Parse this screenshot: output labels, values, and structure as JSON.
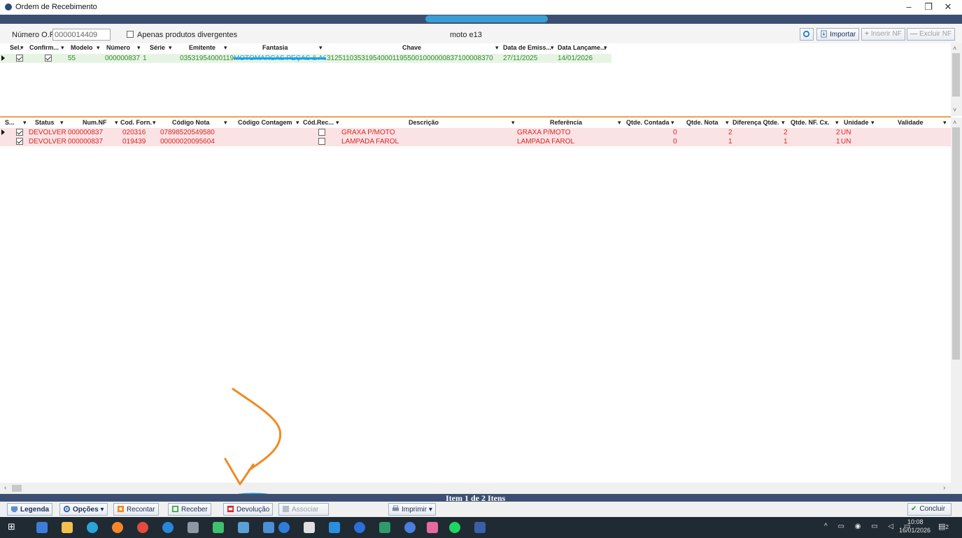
{
  "window": {
    "title": "Ordem de Recebimento",
    "minimize": "–",
    "restore": "❐",
    "close": "✕"
  },
  "filter": {
    "or_label": "Número O.R.:",
    "or_value": "0000014409",
    "divergent_label": "Apenas produtos divergentes",
    "center_text": "moto e13"
  },
  "toolbar": {
    "importar": "Importar",
    "inserir_nf": "Inserir NF",
    "excluir_nf": "Excluir NF"
  },
  "top_grid": {
    "headers": [
      "Sel.",
      "Confirm...",
      "Modelo",
      "Número",
      "Série",
      "Emitente",
      "Fantasia",
      "Chave",
      "Data de Emiss...",
      "Data Lançame..."
    ],
    "rows": [
      {
        "modelo": "55",
        "numero": "000000837",
        "serie": "1",
        "emitente": "03531954000119",
        "fantasia": "MOTOMARCAS PEÇAS & ACE",
        "chave": "3125110353195400011955001000000837100008370",
        "data_emissao": "27/11/2025",
        "data_lancamento": "14/01/2026"
      }
    ]
  },
  "bottom_grid": {
    "headers": [
      "S...",
      "Status",
      "Num.NF",
      "Cod. Forn.",
      "Código Nota",
      "Código Contagem",
      "Cód.Rec...",
      "Descrição",
      "Referência",
      "Qtde. Contada",
      "Qtde. Nota",
      "Diferença Qtde.",
      "Qtde. NF. Cx.",
      "Unidade",
      "Validade"
    ],
    "rows": [
      {
        "status": "DEVOLVER",
        "num_nf": "000000837",
        "cod_forn": "020316",
        "codigo_nota": "07898520549580",
        "descricao": "GRAXA P/MOTO",
        "referencia": "GRAXA P/MOTO",
        "qtde_contada": "0",
        "qtde_nota": "2",
        "diferenca": "2",
        "qtde_cx": "2",
        "unidade": "UN"
      },
      {
        "status": "DEVOLVER",
        "num_nf": "000000837",
        "cod_forn": "019439",
        "codigo_nota": "00000020095604",
        "descricao": "LAMPADA FAROL",
        "referencia": "LAMPADA FAROL",
        "qtde_contada": "0",
        "qtde_nota": "1",
        "diferenca": "1",
        "qtde_cx": "1",
        "unidade": "UN"
      }
    ]
  },
  "status_text": "Item 1 de 2 Itens",
  "actions": {
    "legenda": "Legenda",
    "opcoes": "Opções",
    "recontar": "Recontar",
    "receber": "Receber",
    "devolucao": "Devolução",
    "associar": "Associar",
    "imprimir": "Imprimir",
    "concluir": "Concluir"
  },
  "taskbar": {
    "time": "10:08",
    "date": "16/01/2026",
    "notif": "2"
  },
  "colors": {
    "header_bar": "#3c4f72",
    "green_row": "#e7f4e4",
    "red_row": "#fbe2e4",
    "annotation_orange": "#f08a24",
    "annotation_blue": "#1ea0e6"
  }
}
